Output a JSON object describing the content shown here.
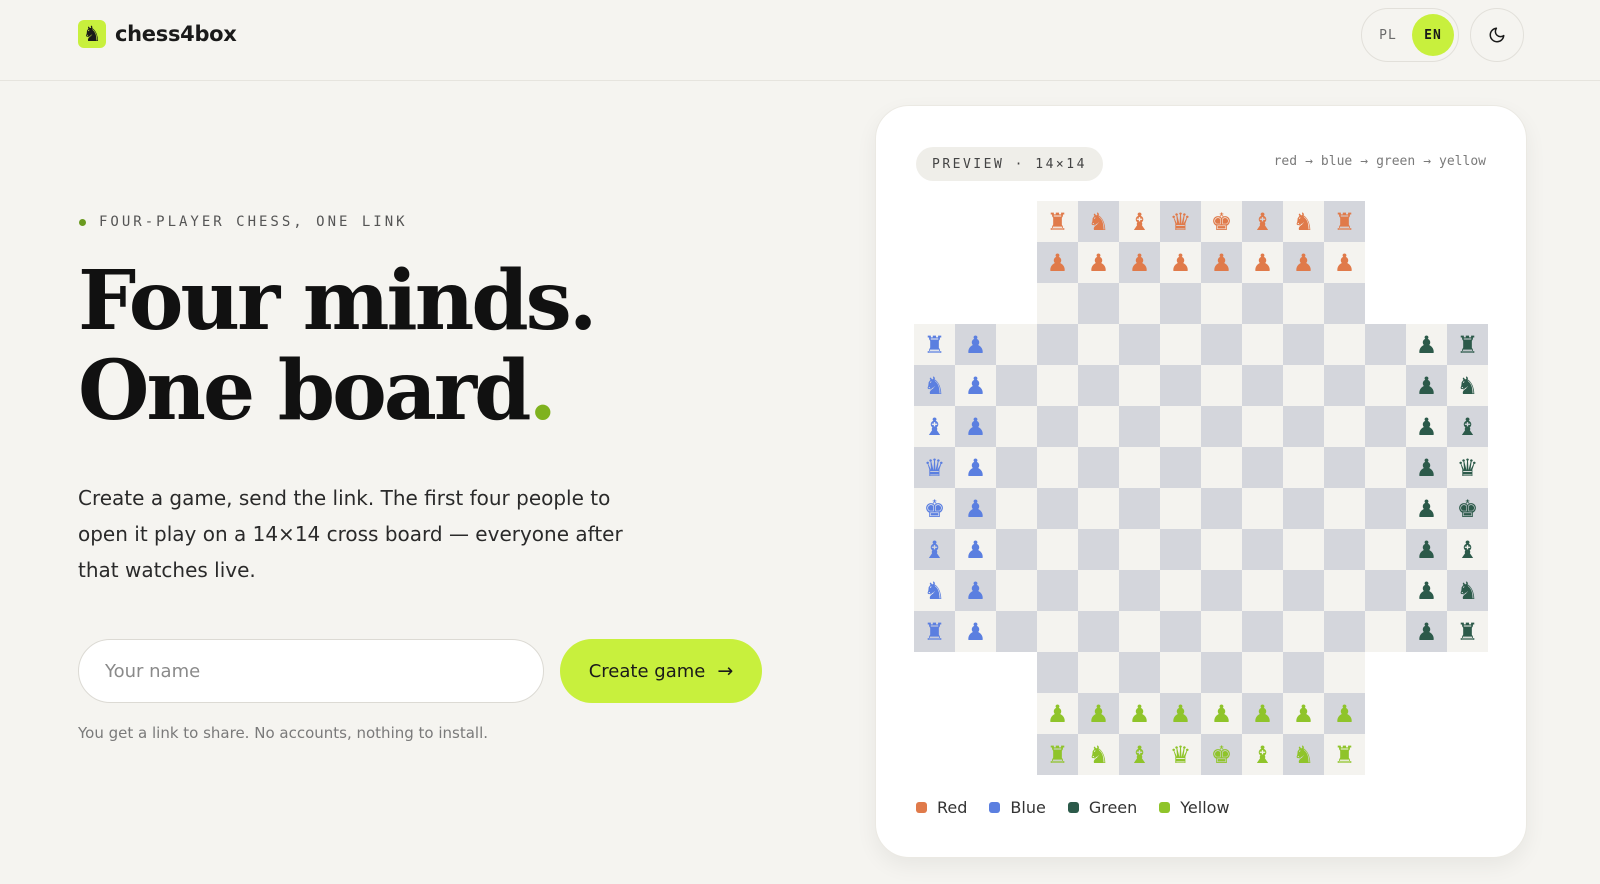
{
  "header": {
    "brand": "chess4box",
    "logo_glyph": "♞",
    "lang": {
      "pl": "PL",
      "en": "EN",
      "active": "EN"
    },
    "theme_icon": "moon-icon"
  },
  "hero": {
    "eyebrow": "FOUR-PLAYER CHESS, ONE LINK",
    "headline_line1": "Four minds.",
    "headline_line2": "One board",
    "headline_dot": ".",
    "subtitle": "Create a game, send the link. The first four people to open it play on a 14×14 cross board — everyone after that watches live.",
    "name_placeholder": "Your name",
    "name_value": "",
    "create_label": "Create game",
    "create_arrow": "→",
    "hint": "You get a link to share. No accounts, nothing to install."
  },
  "preview": {
    "badge": "PREVIEW · 14×14",
    "turn_order": [
      "red",
      "→",
      "blue",
      "→",
      "green",
      "→",
      "yellow"
    ],
    "board_size": 14,
    "cutout": 3,
    "colors": {
      "red": "#e07a4a",
      "blue": "#5b7fe0",
      "green": "#2c5a4a",
      "yellow": "#8fc42a",
      "light": "#f4f3ef",
      "dark": "#d4d6dc"
    },
    "back_rank": [
      "♜",
      "♞",
      "♝",
      "♛",
      "♚",
      "♝",
      "♞",
      "♜"
    ],
    "pawn": "♟",
    "legend": [
      {
        "label": "Red",
        "color": "#e07a4a"
      },
      {
        "label": "Blue",
        "color": "#5b7fe0"
      },
      {
        "label": "Green",
        "color": "#2c5a4a"
      },
      {
        "label": "Yellow",
        "color": "#8fc42a"
      }
    ]
  },
  "accent": "#c8f03d"
}
